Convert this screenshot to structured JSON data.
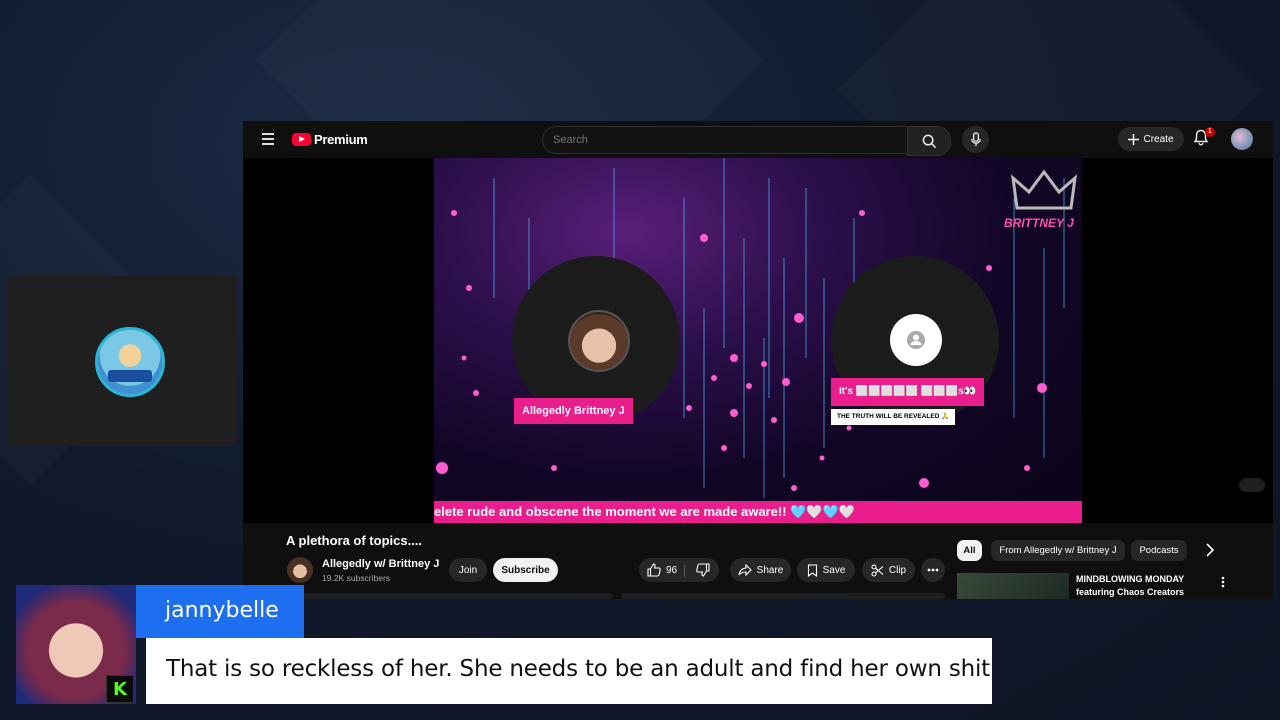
{
  "topbar": {
    "logo_text": "Premium",
    "search_placeholder": "Search",
    "create_label": "Create",
    "notification_count": "1"
  },
  "stream": {
    "host1_name": "Allegedly Brittney J",
    "host2_name": "It's ⬜⬜⬜⬜⬜ ⬜⬜⬜s👀",
    "host2_subtitle": "THE TRUTH WILL BE REVEALED 🙏",
    "brand": "BRITTNEY J",
    "ticker": "elete rude and obscene the moment we are made aware!! 🩵🤍🩵🤍"
  },
  "video": {
    "title": "A plethora of topics....",
    "channel_name": "Allegedly w/ Brittney J",
    "subscribers": "19.2K subscribers",
    "join_label": "Join",
    "subscribe_label": "Subscribe",
    "like_count": "96",
    "share_label": "Share",
    "save_label": "Save",
    "clip_label": "Clip"
  },
  "sidebar": {
    "chips": [
      "All",
      "From Allegedly w/ Brittney J",
      "Podcasts"
    ],
    "recommendation_title": "MINDBLOWING MONDAY featuring Chaos Creators"
  },
  "chat": {
    "username": "jannybelle",
    "message": "That is so reckless of her. She needs to be an adult and find her own shit",
    "platform_badge": "K"
  },
  "colors": {
    "yt_red": "#ff0033",
    "stream_pink": "#e91e8c",
    "chat_blue": "#1e6ef0",
    "kick_green": "#53fc18"
  }
}
